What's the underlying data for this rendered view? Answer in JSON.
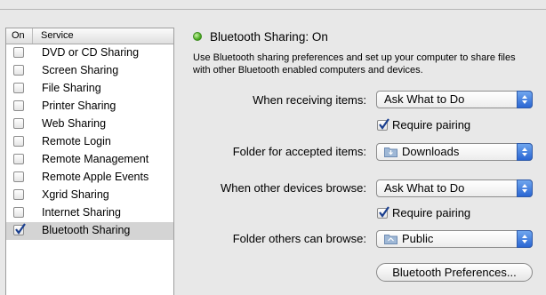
{
  "services": {
    "header_on": "On",
    "header_service": "Service",
    "items": [
      {
        "label": "DVD or CD Sharing",
        "checked": false
      },
      {
        "label": "Screen Sharing",
        "checked": false
      },
      {
        "label": "File Sharing",
        "checked": false
      },
      {
        "label": "Printer Sharing",
        "checked": false
      },
      {
        "label": "Web Sharing",
        "checked": false
      },
      {
        "label": "Remote Login",
        "checked": false
      },
      {
        "label": "Remote Management",
        "checked": false
      },
      {
        "label": "Remote Apple Events",
        "checked": false
      },
      {
        "label": "Xgrid Sharing",
        "checked": false
      },
      {
        "label": "Internet Sharing",
        "checked": false
      },
      {
        "label": "Bluetooth Sharing",
        "checked": true,
        "selected": true
      }
    ]
  },
  "status": {
    "title": "Bluetooth Sharing: On",
    "indicator_color": "#4fae25",
    "description": "Use Bluetooth sharing preferences and set up your computer to share files\nwith other Bluetooth enabled computers and devices."
  },
  "settings": {
    "receiving_label": "When receiving items:",
    "receiving_value": "Ask What to Do",
    "receiving_require_pairing": "Require pairing",
    "accepted_folder_label": "Folder for accepted items:",
    "accepted_folder_value": "Downloads",
    "browse_label": "When other devices browse:",
    "browse_value": "Ask What to Do",
    "browse_require_pairing": "Require pairing",
    "browse_folder_label": "Folder others can browse:",
    "browse_folder_value": "Public"
  },
  "buttons": {
    "bluetooth_preferences": "Bluetooth Preferences..."
  }
}
